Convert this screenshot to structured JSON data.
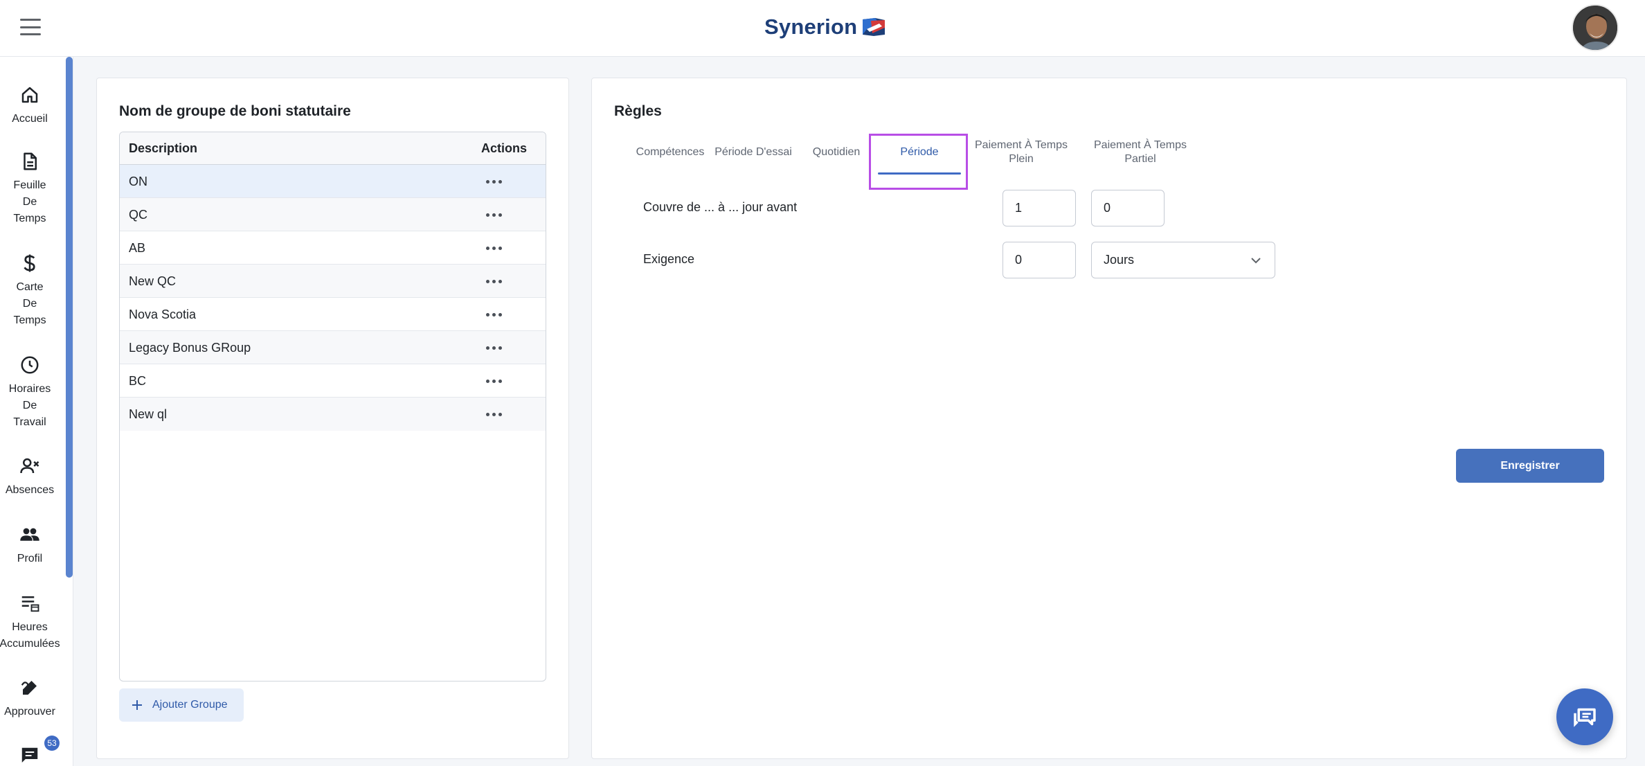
{
  "header": {
    "brand": "Synerion",
    "menu_icon": "hamburger-menu-icon",
    "avatar_icon": "user-avatar"
  },
  "sidebar": {
    "items": [
      {
        "label": "Accueil",
        "icon": "home-icon"
      },
      {
        "label": "Feuille\nDe\nTemps",
        "icon": "document-icon"
      },
      {
        "label": "Carte\nDe\nTemps",
        "icon": "dollar-icon"
      },
      {
        "label": "Horaires\nDe\nTravail",
        "icon": "clock-icon"
      },
      {
        "label": "Absences",
        "icon": "person-remove-icon"
      },
      {
        "label": "Profil",
        "icon": "people-icon"
      },
      {
        "label": "Heures\nAccumulées",
        "icon": "list-calendar-icon"
      },
      {
        "label": "Approuver",
        "icon": "approve-pen-icon"
      },
      {
        "label": "",
        "icon": "chat-icon",
        "badge": "53"
      }
    ]
  },
  "groups_panel": {
    "title": "Nom de groupe de boni statutaire",
    "columns": {
      "description": "Description",
      "actions": "Actions"
    },
    "rows": [
      {
        "description": "ON"
      },
      {
        "description": "QC"
      },
      {
        "description": "AB"
      },
      {
        "description": "New QC"
      },
      {
        "description": "Nova Scotia"
      },
      {
        "description": "Legacy Bonus GRoup"
      },
      {
        "description": "BC"
      },
      {
        "description": "New ql"
      }
    ],
    "add_button": "Ajouter Groupe"
  },
  "rules_panel": {
    "title": "Règles",
    "tabs": [
      {
        "label": "Compétences"
      },
      {
        "label": "Période D'essai"
      },
      {
        "label": "Quotidien"
      },
      {
        "label": "Période",
        "active": true
      },
      {
        "label": "Paiement À Temps Plein"
      },
      {
        "label": "Paiement À Temps Partiel"
      }
    ],
    "fields": {
      "coverage_label": "Couvre de ... à ... jour avant",
      "coverage_from": "1",
      "coverage_to": "0",
      "requirement_label": "Exigence",
      "requirement_value": "0",
      "requirement_unit": "Jours"
    },
    "save_button": "Enregistrer"
  },
  "colors": {
    "accent": "#3f6bc4",
    "brand": "#1e3f78",
    "tab_highlight": "#b84ee6",
    "selected_row": "#e8f0fb"
  }
}
